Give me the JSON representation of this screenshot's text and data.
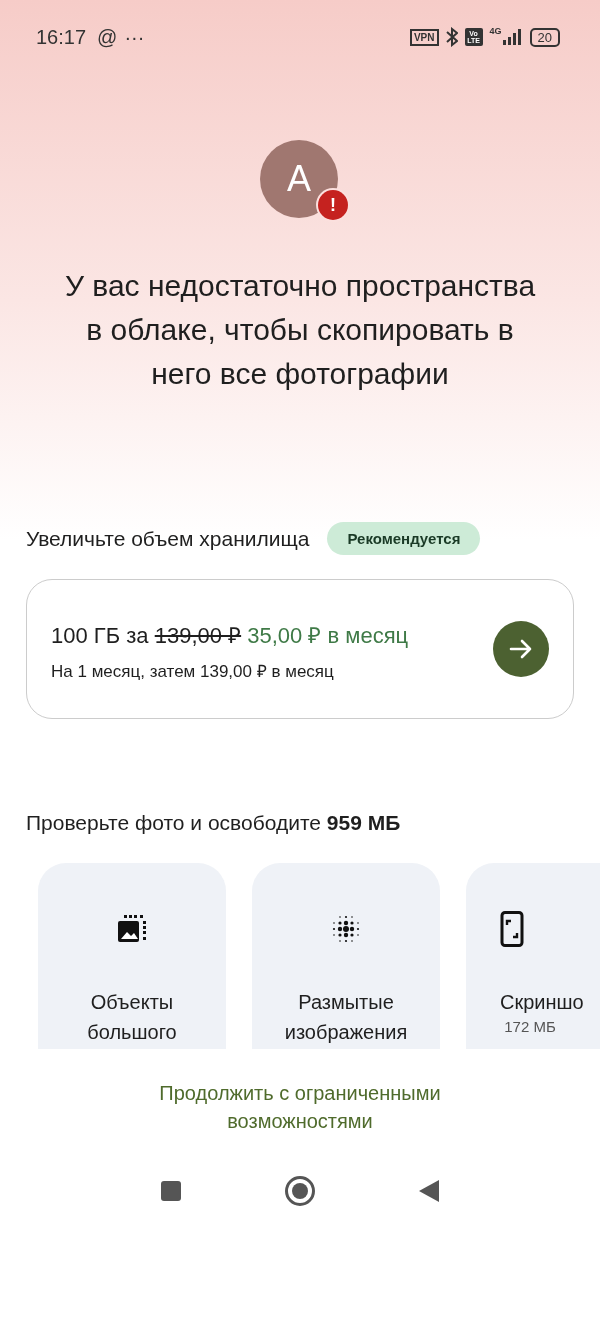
{
  "status_bar": {
    "time": "16:17",
    "at": "@",
    "more": "···",
    "vpn": "VPN",
    "volte": "Vo LTE",
    "network": "4G",
    "battery": "20"
  },
  "account": {
    "initial": "A",
    "warning": "!"
  },
  "headline": "У вас недостаточно пространства в облаке, чтобы скопировать в него все фотографии",
  "upgrade": {
    "title": "Увеличьте объем хранилища",
    "badge": "Рекомендуется",
    "offer": {
      "prefix": "100 ГБ за",
      "old_price": "139,00 ₽",
      "new_price": "35,00 ₽ в месяц",
      "note": "На 1 месяц, затем 139,00 ₽ в месяц"
    }
  },
  "review": {
    "title": "Проверьте фото и освободите **959 МБ**",
    "categories": [
      {
        "kind": "large",
        "label": "Объекты большого"
      },
      {
        "kind": "blurry",
        "label": "Размытые изображения"
      },
      {
        "kind": "screenshots",
        "label": "Скриншо",
        "size": "172 МБ"
      }
    ]
  },
  "continue_link": "Продолжить с ограниченными возможностями"
}
